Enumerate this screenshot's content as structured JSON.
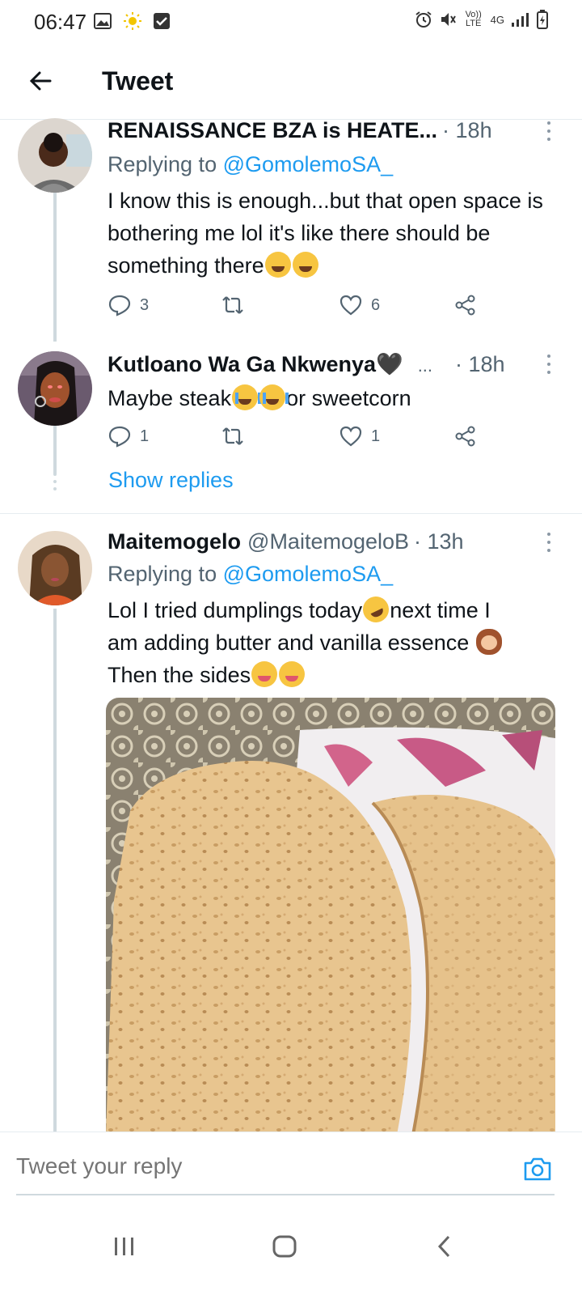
{
  "status_bar": {
    "time": "06:47",
    "left_icons": [
      "image-icon",
      "brightness-icon",
      "check-box-icon"
    ],
    "right_icons": [
      "alarm-icon",
      "mute-icon",
      "volte-icon",
      "4g-icon",
      "signal-icon",
      "battery-icon"
    ],
    "volte_label": "Vo)) LTE",
    "network_label": "4G"
  },
  "header": {
    "title": "Tweet"
  },
  "tweets": [
    {
      "name": "RENAISSANCE BZA is HEATE...",
      "time": "· 18h",
      "replying_label": "Replying to",
      "replying_handle": "@GomolemoSA_",
      "body": "I know this is enough...but that open space is bothering me lol it's like there should be something there",
      "emoji": [
        "weary-face-emoji",
        "weary-face-emoji"
      ],
      "replies": "3",
      "retweets": "",
      "likes": "6"
    },
    {
      "name": "Kutloano Wa Ga Nkwenya🖤",
      "name_suffix": "...",
      "time": "· 18h",
      "body_part1": "Maybe steak",
      "body_part2": "or sweetcorn",
      "emoji": [
        "crying-face-emoji",
        "crying-face-emoji"
      ],
      "replies": "1",
      "retweets": "",
      "likes": "1",
      "show_replies": "Show replies"
    },
    {
      "name": "Maitemogelo",
      "handle": "@MaitemogeloB",
      "time": "· 13h",
      "replying_label": "Replying to",
      "replying_handle": "@GomolemoSA_",
      "body_line1a": "Lol I tried dumplings today",
      "body_line1b": "next time I",
      "body_line2": "am adding butter and vanilla essence",
      "body_line3": "Then the sides",
      "emoji": [
        "rofl-emoji",
        "see-no-evil-monkey-emoji",
        "yum-face-emoji",
        "yum-face-emoji"
      ]
    }
  ],
  "reply_bar": {
    "placeholder": "Tweet your reply"
  },
  "colors": {
    "accent": "#1d9bf0",
    "text": "#0f1419",
    "secondary": "#536471",
    "divider": "#e6ecf0"
  }
}
